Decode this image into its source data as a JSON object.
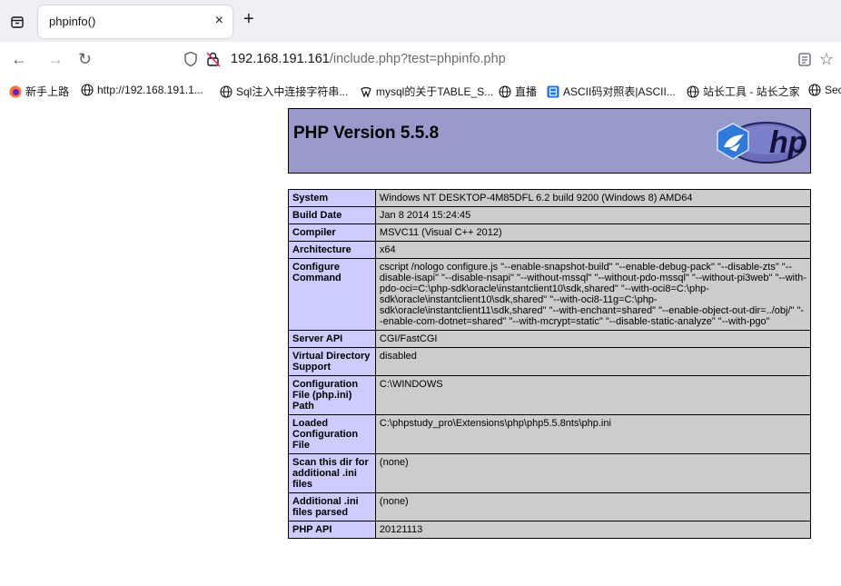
{
  "browser": {
    "tab": {
      "title": "phpinfo()",
      "close": "×"
    },
    "new_tab": "+",
    "url": {
      "host": "192.168.191.161",
      "path": "/include.php?test=phpinfo.php"
    },
    "bookmarks": [
      {
        "label": "新手上路",
        "icon": "firefox-icon"
      },
      {
        "label": "http://192.168.191.1...",
        "icon": "globe-icon"
      },
      {
        "label": "Sql注入中连接字符串...",
        "icon": "globe-icon"
      },
      {
        "label": "mysql的关于TABLE_S...",
        "icon": "csdn-icon"
      },
      {
        "label": "直播",
        "icon": "globe-icon"
      },
      {
        "label": "ASCII码对照表|ASCII...",
        "icon": "app-icon"
      },
      {
        "label": "站长工具 - 站长之家",
        "icon": "globe-icon"
      },
      {
        "label": "Sec",
        "icon": "globe-icon"
      }
    ]
  },
  "phpinfo": {
    "title": "PHP Version 5.5.8",
    "rows": [
      {
        "key": "System",
        "value": "Windows NT DESKTOP-4M85DFL 6.2 build 9200 (Windows 8) AMD64"
      },
      {
        "key": "Build Date",
        "value": "Jan 8 2014 15:24:45"
      },
      {
        "key": "Compiler",
        "value": "MSVC11 (Visual C++ 2012)"
      },
      {
        "key": "Architecture",
        "value": "x64"
      },
      {
        "key": "Configure Command",
        "value": "cscript /nologo configure.js \"--enable-snapshot-build\" \"--enable-debug-pack\" \"--disable-zts\" \"--disable-isapi\" \"--disable-nsapi\" \"--without-mssql\" \"--without-pdo-mssql\" \"--without-pi3web\" \"--with-pdo-oci=C:\\php-sdk\\oracle\\instantclient10\\sdk,shared\" \"--with-oci8=C:\\php-sdk\\oracle\\instantclient10\\sdk,shared\" \"--with-oci8-11g=C:\\php-sdk\\oracle\\instantclient11\\sdk,shared\" \"--with-enchant=shared\" \"--enable-object-out-dir=../obj/\" \"--enable-com-dotnet=shared\" \"--with-mcrypt=static\" \"--disable-static-analyze\" \"--with-pgo\""
      },
      {
        "key": "Server API",
        "value": "CGI/FastCGI"
      },
      {
        "key": "Virtual Directory Support",
        "value": "disabled"
      },
      {
        "key": "Configuration File (php.ini) Path",
        "value": "C:\\WINDOWS"
      },
      {
        "key": "Loaded Configuration File",
        "value": "C:\\phpstudy_pro\\Extensions\\php\\php5.5.8nts\\php.ini"
      },
      {
        "key": "Scan this dir for additional .ini files",
        "value": "(none)"
      },
      {
        "key": "Additional .ini files parsed",
        "value": "(none)"
      },
      {
        "key": "PHP API",
        "value": "20121113"
      }
    ]
  }
}
